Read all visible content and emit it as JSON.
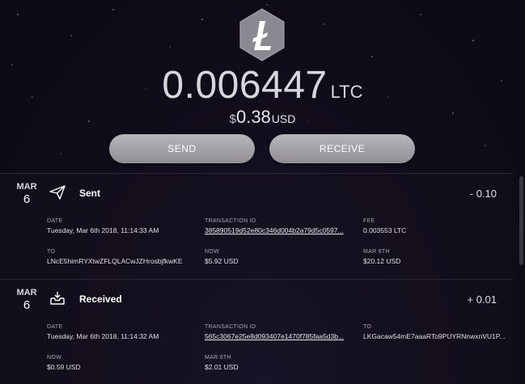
{
  "wallet": {
    "coin_icon": "litecoin-logo-icon",
    "balance": "0.006447",
    "balance_unit": "LTC",
    "usd_symbol": "$",
    "usd_value": "0.38",
    "usd_unit": "USD",
    "send_label": "SEND",
    "receive_label": "RECEIVE"
  },
  "transactions": [
    {
      "month": "MAR",
      "day": "6",
      "icon": "send-paper-plane-icon",
      "type": "Sent",
      "amount": "- 0.10",
      "date_label": "DATE",
      "date": "Tuesday, Mar 6th 2018, 11:14:33 AM",
      "txid_label": "TRANSACTION ID",
      "txid": "385890519d52e80c346d004b2a79d5c0597...",
      "fee_label": "FEE",
      "fee": "0.003553 LTC",
      "to_label": "TO",
      "to": "LNcE5himRYXtwZFLQLACwJZHrosbjfkwKE",
      "now_label": "NOW",
      "now": "$5.92 USD",
      "then_label": "MAR 6TH",
      "then": "$20.12 USD"
    },
    {
      "month": "MAR",
      "day": "6",
      "icon": "receive-inbox-icon",
      "type": "Received",
      "amount": "+ 0.01",
      "date_label": "DATE",
      "date": "Tuesday, Mar 6th 2018, 11:14:32 AM",
      "txid_label": "TRANSACTION ID",
      "txid": "565c3067e25e8d093407e1470f785faa5d3b...",
      "to_label": "TO",
      "to": "LKGacaw54mE7aaaRTo9PUYRNnwxnVU1P...",
      "now_label": "NOW",
      "now": "$0.59 USD",
      "then_label": "MAR 6TH",
      "then": "$2.01 USD"
    }
  ]
}
